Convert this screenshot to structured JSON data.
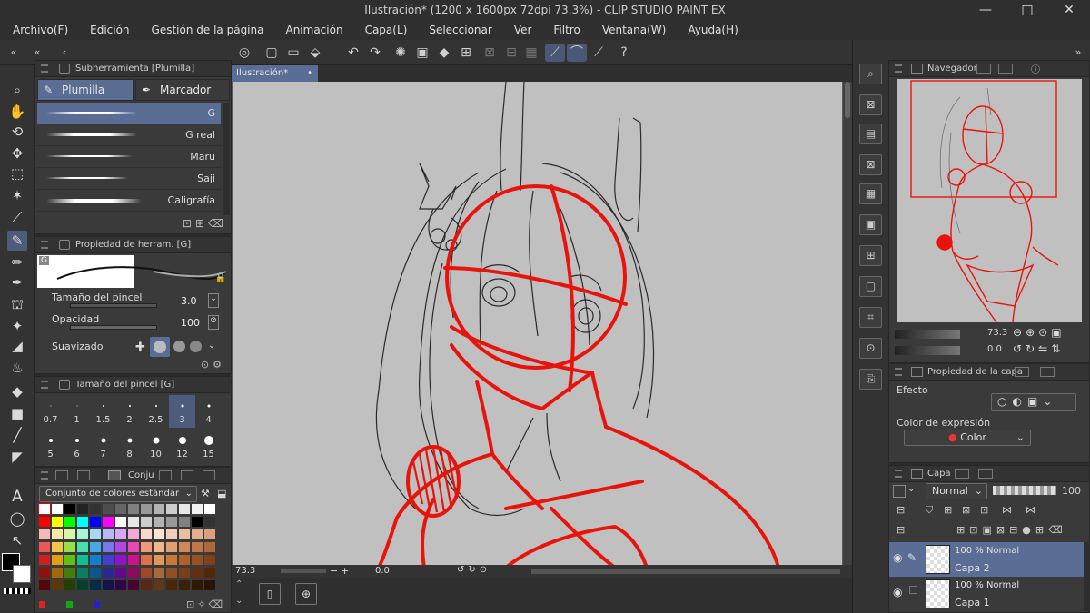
{
  "window": {
    "title": "Ilustración* (1200 x 1600px 72dpi 73.3%)  - CLIP STUDIO PAINT EX",
    "controls": [
      "—",
      "□",
      "✕"
    ]
  },
  "menu": [
    "Archivo(F)",
    "Edición",
    "Gestión de la página",
    "Animación",
    "Capa(L)",
    "Seleccionar",
    "Ver",
    "Filtro",
    "Ventana(W)",
    "Ayuda(H)"
  ],
  "subtool_panel": {
    "title": "Subherramienta [Plumilla]",
    "tabs": [
      "Plumilla",
      "Marcador"
    ],
    "brushes": [
      {
        "name": "G",
        "selected": true
      },
      {
        "name": "G real",
        "selected": false
      },
      {
        "name": "Maru",
        "selected": false
      },
      {
        "name": "Saji",
        "selected": false
      },
      {
        "name": "Caligrafía",
        "selected": false
      }
    ]
  },
  "tool_property": {
    "title": "Propiedad de herram. [G]",
    "preview_label": "G",
    "brush_size_label": "Tamaño del pincel",
    "brush_size_value": "3.0",
    "opacity_label": "Opacidad",
    "opacity_value": "100",
    "smoothing_label": "Suavizado"
  },
  "brush_size_panel": {
    "title": "Tamaño del pincel [G]",
    "sizes": [
      "0.7",
      "1",
      "1.5",
      "2",
      "2.5",
      "3",
      "4",
      "5",
      "6",
      "7",
      "8",
      "10",
      "12",
      "15"
    ],
    "selected": "3"
  },
  "color_panel": {
    "tab_label": "Conju",
    "set_name": "Conjunto de colores estándar"
  },
  "canvas": {
    "tab_label": "Ilustración*",
    "zoom_readout": "73.3",
    "rotation_readout": "0.0"
  },
  "navigator": {
    "title": "Navegador",
    "zoom": "73.3",
    "rotation": "0.0"
  },
  "layer_property": {
    "title": "Propiedad de la capa",
    "effect_label": "Efecto",
    "expression_label": "Color de expresión",
    "expression_value": "Color"
  },
  "layer_panel": {
    "title": "Capa",
    "blend_mode": "Normal",
    "opacity": "100",
    "layers": [
      {
        "mode": "100 % Normal",
        "name": "Capa 2",
        "selected": true
      },
      {
        "mode": "100 % Normal",
        "name": "Capa 1",
        "selected": false
      }
    ]
  },
  "colors": {
    "accent": "#5a6d94",
    "sketch_red": "#e8140c",
    "paper": "#c0c0c0"
  },
  "icons": {
    "tools": [
      "magnifier-icon",
      "hand-icon",
      "rotate-icon",
      "move-icon",
      "selection-icon",
      "auto-select-icon",
      "eyedropper-icon",
      "pen-icon",
      "pencil-icon",
      "brush-icon",
      "airbrush-icon",
      "decoration-icon",
      "eraser-icon",
      "blend-icon",
      "fill-icon",
      "gradient-icon",
      "figure-icon",
      "ruler-icon",
      "text-icon",
      "balloon-icon",
      "correct-line-icon"
    ]
  }
}
